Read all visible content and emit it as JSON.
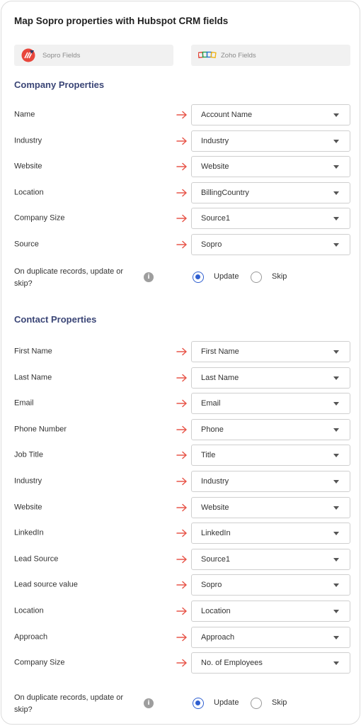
{
  "title": "Map Sopro properties with Hubspot CRM fields",
  "sources": {
    "left": "Sopro Fields",
    "right": "Zoho Fields",
    "left_icon": "sopro-logo-icon",
    "right_icon": "zoho-logo-icon"
  },
  "company": {
    "heading": "Company Properties",
    "rows": [
      {
        "label": "Name",
        "value": "Account Name"
      },
      {
        "label": "Industry",
        "value": "Industry"
      },
      {
        "label": "Website",
        "value": "Website"
      },
      {
        "label": "Location",
        "value": "BillingCountry"
      },
      {
        "label": "Company Size",
        "value": "Source1"
      },
      {
        "label": "Source",
        "value": "Sopro"
      }
    ],
    "duplicate": {
      "label": "On duplicate records, update or skip?",
      "info": "i",
      "options": [
        "Update",
        "Skip"
      ],
      "selected": "Update"
    }
  },
  "contact": {
    "heading": "Contact Properties",
    "rows": [
      {
        "label": "First Name",
        "value": "First Name"
      },
      {
        "label": "Last Name",
        "value": "Last Name"
      },
      {
        "label": "Email",
        "value": "Email"
      },
      {
        "label": "Phone Number",
        "value": "Phone"
      },
      {
        "label": "Job Title",
        "value": "Title"
      },
      {
        "label": "Industry",
        "value": "Industry"
      },
      {
        "label": "Website",
        "value": "Website"
      },
      {
        "label": "LinkedIn",
        "value": "LinkedIn"
      },
      {
        "label": "Lead Source",
        "value": "Source1"
      },
      {
        "label": "Lead source value",
        "value": "Sopro"
      },
      {
        "label": "Location",
        "value": "Location"
      },
      {
        "label": "Approach",
        "value": "Approach"
      },
      {
        "label": "Company Size",
        "value": "No. of Employees"
      }
    ],
    "duplicate": {
      "label": "On duplicate records, update or skip?",
      "info": "i",
      "options": [
        "Update",
        "Skip"
      ],
      "selected": "Update"
    }
  },
  "colors": {
    "arrow": "#e8564a",
    "heading": "#3a4576",
    "radio": "#2f5fd0"
  }
}
